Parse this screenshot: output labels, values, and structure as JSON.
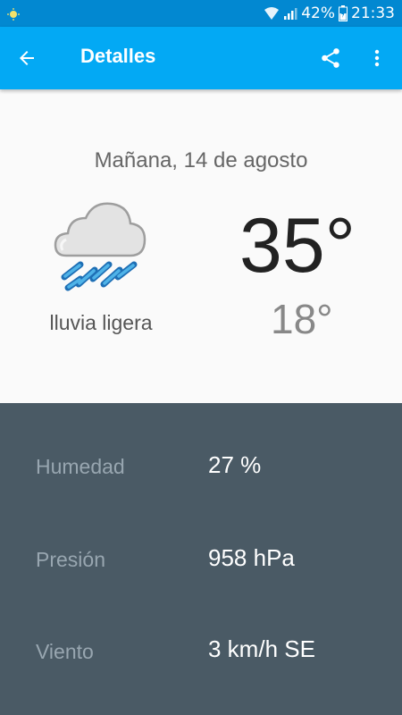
{
  "status_bar": {
    "battery_percent": "42%",
    "time": "21:33",
    "icons": [
      "weather-indicator-icon",
      "wifi-icon",
      "signal-icon",
      "battery-charging-icon"
    ]
  },
  "app_bar": {
    "title": "Detalles",
    "back_icon": "arrow-back-icon",
    "share_icon": "share-icon",
    "more_icon": "more-vert-icon",
    "color": "#03a9f4"
  },
  "forecast": {
    "date": "Mañana, 14 de agosto",
    "condition": "lluvia ligera",
    "condition_icon": "light-rain-icon",
    "temp_high": "35°",
    "temp_low": "18°"
  },
  "details": [
    {
      "label": "Humedad",
      "value": "27 %"
    },
    {
      "label": "Presión",
      "value": "958 hPa"
    },
    {
      "label": "Viento",
      "value": "3 km/h SE"
    }
  ]
}
